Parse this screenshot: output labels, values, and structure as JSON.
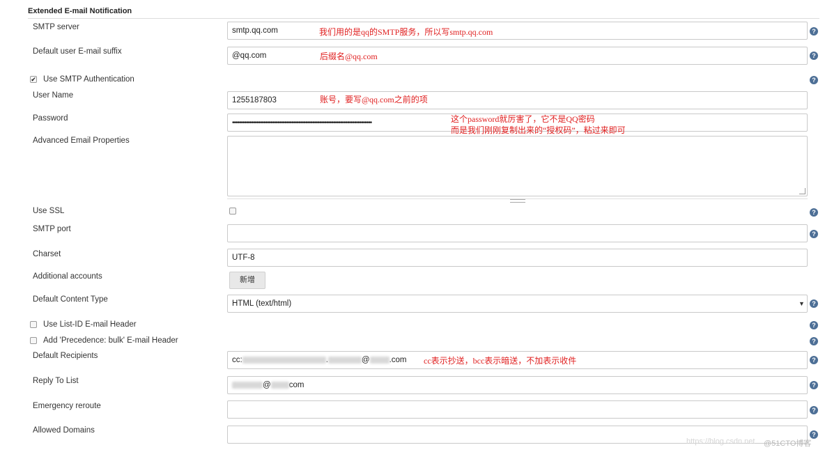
{
  "section": {
    "title": "Extended E-mail Notification"
  },
  "help_glyph": "?",
  "fields": {
    "smtp_server": {
      "label": "SMTP server",
      "value": "smtp.qq.com"
    },
    "email_suffix": {
      "label": "Default user E-mail suffix",
      "value": "@qq.com"
    },
    "use_smtp_auth": {
      "label": "Use SMTP Authentication",
      "checked": true
    },
    "user_name": {
      "label": "User Name",
      "value": "1255187803"
    },
    "password": {
      "label": "Password",
      "value": "••••••••••••••••••••••••••••••••••••••••••••••••••••••••••••••••••••••••••••••••"
    },
    "advanced_props": {
      "label": "Advanced Email Properties",
      "value": ""
    },
    "use_ssl": {
      "label": "Use SSL",
      "checked": false
    },
    "smtp_port": {
      "label": "SMTP port",
      "value": ""
    },
    "charset": {
      "label": "Charset",
      "value": "UTF-8"
    },
    "additional_accounts": {
      "label": "Additional accounts",
      "button": "新增"
    },
    "content_type": {
      "label": "Default Content Type",
      "value": "HTML (text/html)",
      "arrow": "▼"
    },
    "list_id": {
      "label": "Use List-ID E-mail Header",
      "checked": false
    },
    "precedence": {
      "label": "Add 'Precedence: bulk' E-mail Header",
      "checked": false
    },
    "recipients": {
      "label": "Default Recipients",
      "p1": "cc:",
      "p2": ".",
      "p3": "@",
      "p4": ".com"
    },
    "reply_to": {
      "label": "Reply To List",
      "p1": "@",
      "p2": "com"
    },
    "emergency": {
      "label": "Emergency reroute",
      "value": ""
    },
    "allowed_domains": {
      "label": "Allowed Domains",
      "value": ""
    }
  },
  "annotations": {
    "smtp": "我们用的是qq的SMTP服务，所以写smtp.qq.com",
    "suffix": "后缀名@qq.com",
    "user": "账号，要写@qq.com之前的项",
    "password_1": "这个password就厉害了，它不是QQ密码",
    "password_2": "而是我们刚刚复制出来的“授权码”，粘过来即可",
    "recipients": "cc表示抄送，bcc表示暗送，不加表示收件"
  },
  "watermark": {
    "url": "https://blog.csdn.net",
    "brand": "@51CTO博客"
  },
  "colors": {
    "annotation": "#e02020",
    "help_icon": "#4d6f96"
  }
}
